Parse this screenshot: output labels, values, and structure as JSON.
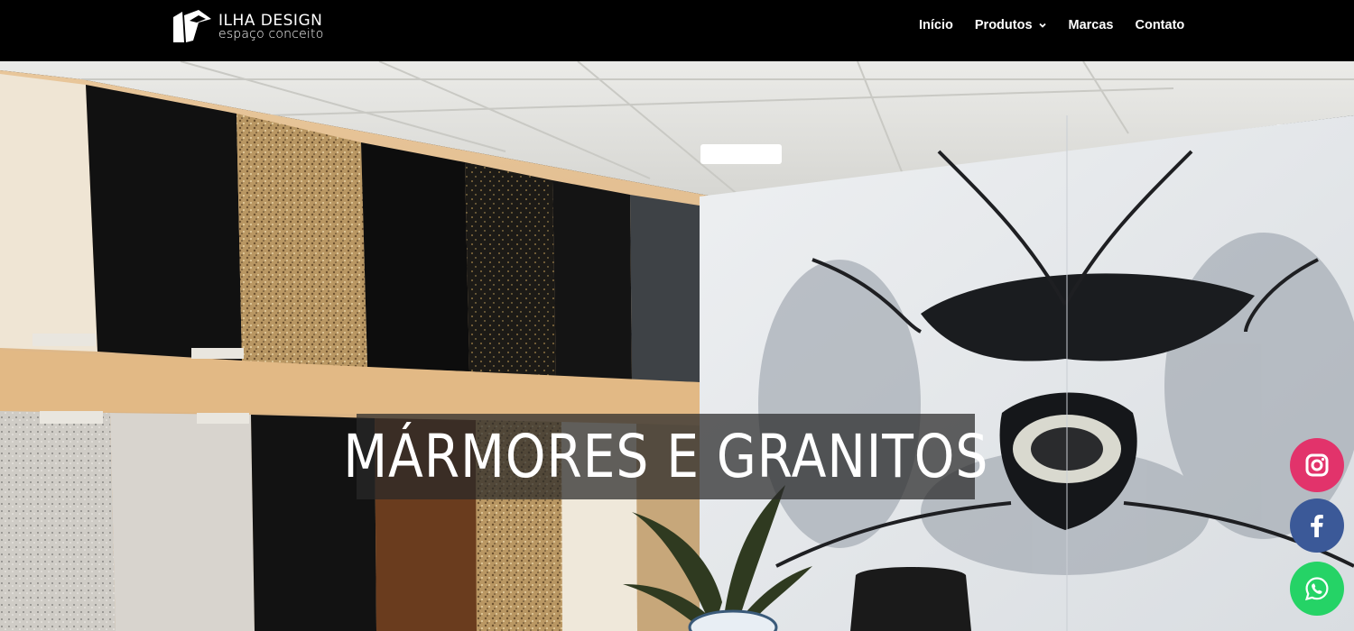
{
  "brand": {
    "title": "ILHA DESIGN",
    "subtitle": "espaço conceito"
  },
  "nav": {
    "items": [
      {
        "label": "Início"
      },
      {
        "label": "Produtos"
      },
      {
        "label": "Marcas"
      },
      {
        "label": "Contato"
      }
    ]
  },
  "hero": {
    "title": "MÁRMORES E GRANITOS",
    "background": "showroom-photo"
  },
  "social": {
    "instagram": {
      "icon": "instagram-icon",
      "color": "#e2336b"
    },
    "facebook": {
      "icon": "facebook-icon",
      "color": "#3b5998"
    },
    "whatsapp": {
      "icon": "whatsapp-icon",
      "color": "#25d366"
    }
  },
  "colors": {
    "header_bg": "#000000",
    "text": "#ffffff"
  }
}
